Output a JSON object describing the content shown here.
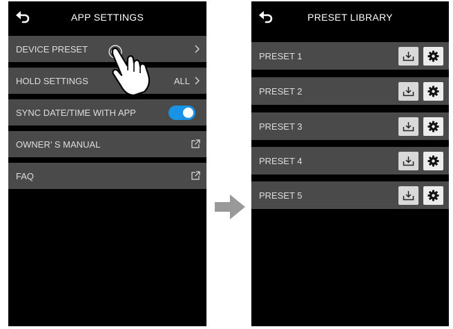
{
  "left_screen": {
    "title": "APP SETTINGS",
    "items": [
      {
        "label": "DEVICE PRESET",
        "value": ""
      },
      {
        "label": "HOLD SETTINGS",
        "value": "ALL"
      },
      {
        "label": "SYNC DATE/TIME WITH APP",
        "toggle": "on"
      },
      {
        "label": "OWNER’ S MANUAL",
        "value": ""
      },
      {
        "label": "FAQ",
        "value": ""
      }
    ]
  },
  "right_screen": {
    "title": "PRESET LIBRARY",
    "presets": [
      {
        "label": "PRESET 1"
      },
      {
        "label": "PRESET 2"
      },
      {
        "label": "PRESET 3"
      },
      {
        "label": "PRESET 4"
      },
      {
        "label": "PRESET 5"
      }
    ]
  },
  "colors": {
    "screen_bg": "#000000",
    "row_bg": "#4a4a4a",
    "row_text": "#dedede",
    "toggle_on": "#1893e6",
    "arrow": "#999999"
  },
  "icons": [
    "back-arrow-icon",
    "chevron-right-icon",
    "external-link-icon",
    "download-icon",
    "gear-icon",
    "right-arrow-icon",
    "pointing-hand-icon"
  ]
}
